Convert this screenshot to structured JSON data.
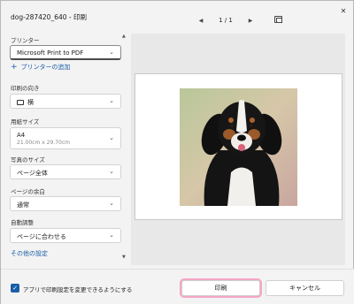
{
  "window": {
    "title": "dog-287420_640 - 印刷",
    "close_glyph": "✕"
  },
  "pager": {
    "prev_glyph": "◀",
    "next_glyph": "▶",
    "page_info": "1 / 1"
  },
  "settings": {
    "printer": {
      "label": "プリンター",
      "value": "Microsoft Print to PDF"
    },
    "add_printer": {
      "label": "プリンターの追加",
      "icon": "+"
    },
    "orientation": {
      "label": "印刷の向き",
      "value": "横"
    },
    "paper_size": {
      "label": "用紙サイズ",
      "value": "A4",
      "sub": "21.00cm x 29.70cm"
    },
    "photo_size": {
      "label": "写真のサイズ",
      "value": "ページ全体"
    },
    "margins": {
      "label": "ページの余白",
      "value": "通常"
    },
    "fit": {
      "label": "自動調整",
      "value": "ページに合わせる"
    },
    "more_settings": "その他の設定",
    "chevron": "⌄"
  },
  "footer": {
    "checkbox_label": "アプリで印刷設定を変更できるようにする",
    "checkbox_checked": true,
    "print_label": "印刷",
    "cancel_label": "キャンセル"
  },
  "colors": {
    "accent": "#1a5ea8",
    "highlight": "#f4a6c6"
  }
}
